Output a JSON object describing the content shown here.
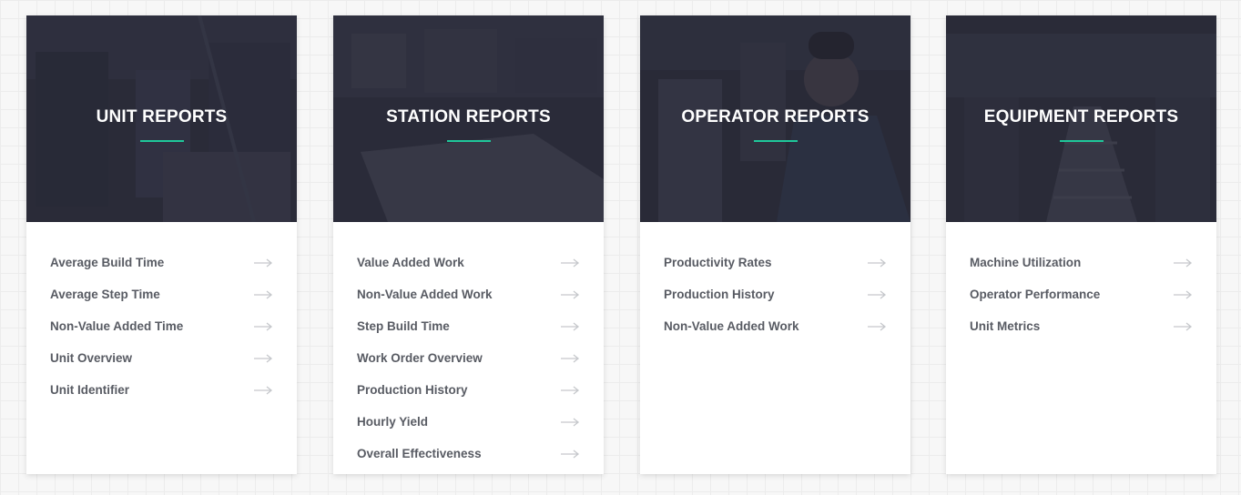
{
  "accent_color": "#1fc79a",
  "cards": [
    {
      "title": "UNIT REPORTS",
      "items": [
        {
          "label": "Average Build Time",
          "icon": "arrow-right-icon"
        },
        {
          "label": "Average Step Time",
          "icon": "arrow-right-icon"
        },
        {
          "label": "Non-Value Added Time",
          "icon": "arrow-right-icon"
        },
        {
          "label": "Unit Overview",
          "icon": "arrow-right-icon"
        },
        {
          "label": "Unit Identifier",
          "icon": "arrow-right-icon"
        }
      ]
    },
    {
      "title": "STATION REPORTS",
      "items": [
        {
          "label": "Value Added Work",
          "icon": "arrow-right-icon"
        },
        {
          "label": "Non-Value Added Work",
          "icon": "arrow-right-icon"
        },
        {
          "label": "Step Build Time",
          "icon": "arrow-right-icon"
        },
        {
          "label": "Work Order Overview",
          "icon": "arrow-right-icon"
        },
        {
          "label": "Production History",
          "icon": "arrow-right-icon"
        },
        {
          "label": "Hourly Yield",
          "icon": "arrow-right-icon"
        },
        {
          "label": "Overall Effectiveness",
          "icon": "arrow-right-icon"
        }
      ]
    },
    {
      "title": "OPERATOR REPORTS",
      "items": [
        {
          "label": "Productivity Rates",
          "icon": "arrow-right-icon"
        },
        {
          "label": "Production History",
          "icon": "arrow-right-icon"
        },
        {
          "label": "Non-Value Added Work",
          "icon": "arrow-right-icon"
        }
      ]
    },
    {
      "title": "EQUIPMENT REPORTS",
      "items": [
        {
          "label": "Machine Utilization",
          "icon": "arrow-right-icon"
        },
        {
          "label": "Operator Performance",
          "icon": "arrow-right-icon"
        },
        {
          "label": "Unit Metrics",
          "icon": "arrow-right-icon"
        }
      ]
    }
  ]
}
